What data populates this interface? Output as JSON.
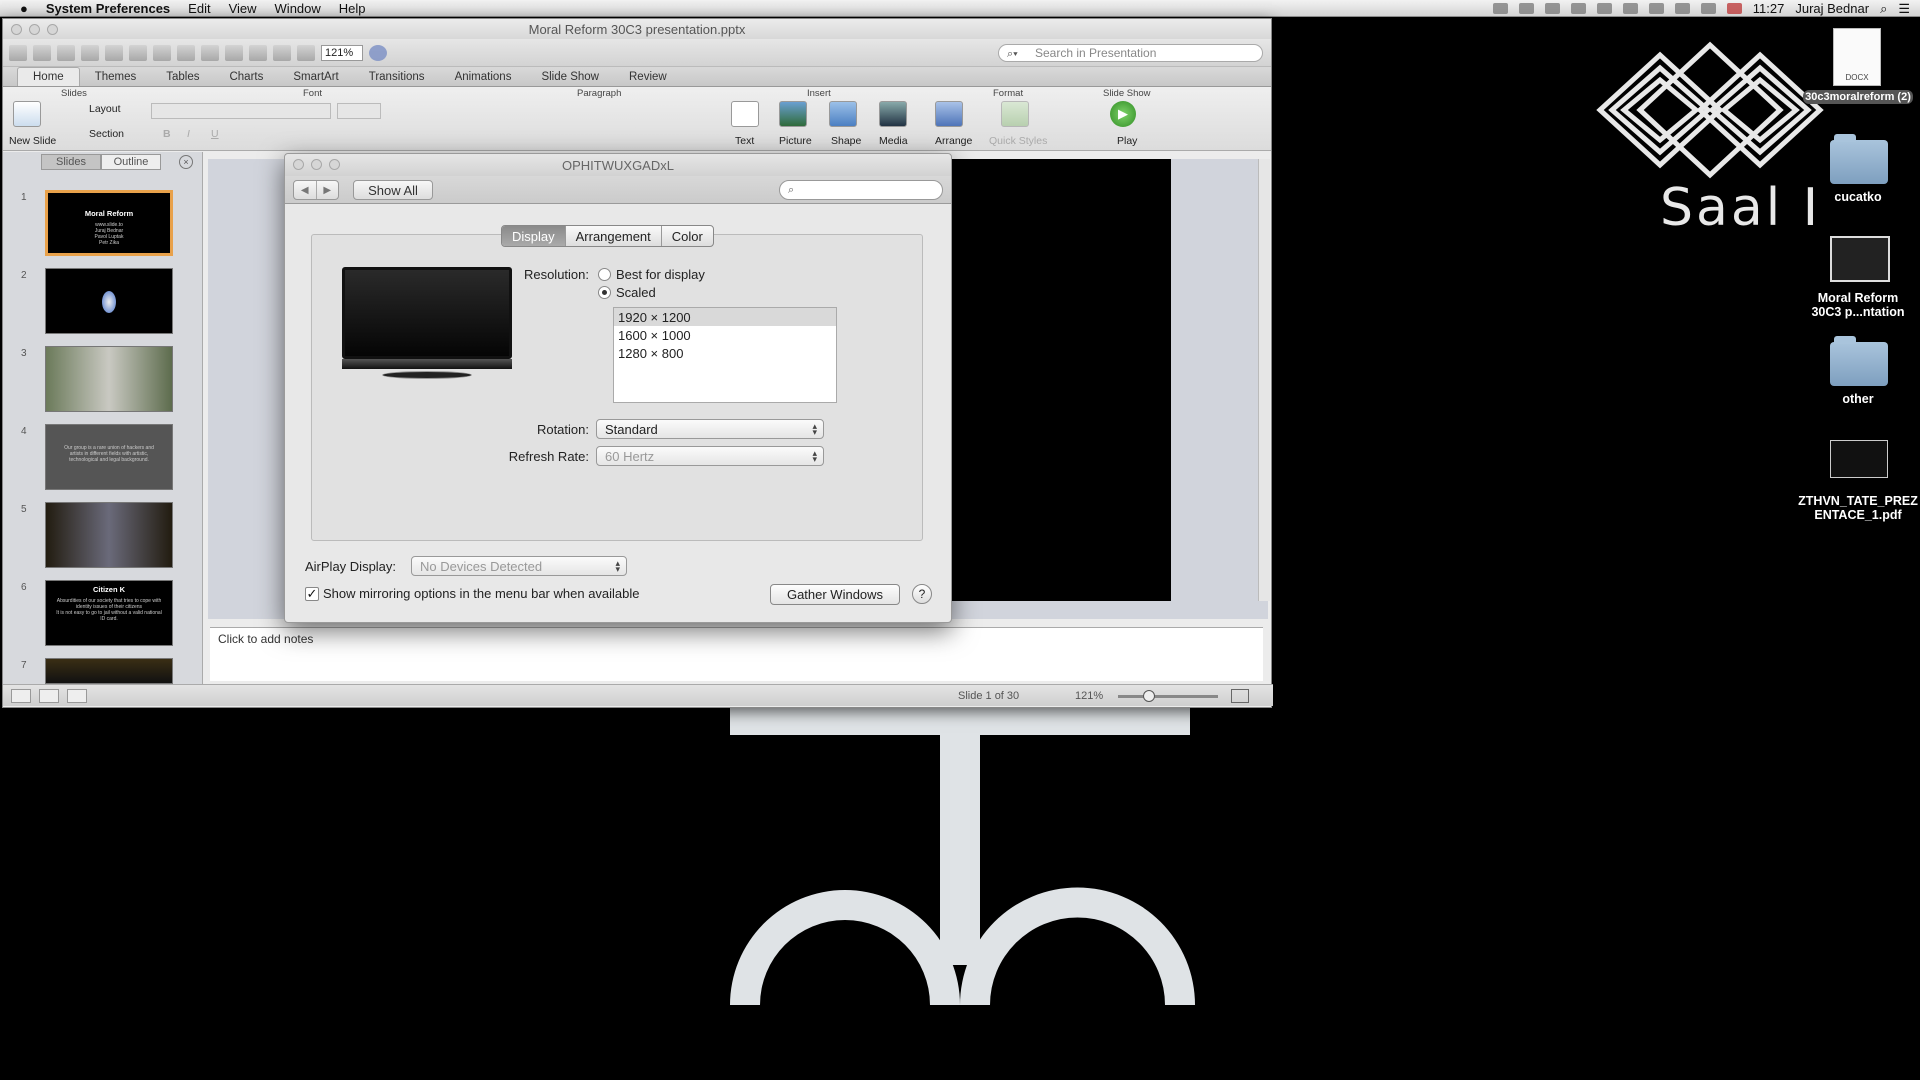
{
  "menubar": {
    "app": "System Preferences",
    "items": [
      "Edit",
      "View",
      "Window",
      "Help"
    ],
    "time": "11:27",
    "user": "Juraj Bednar"
  },
  "ppt": {
    "title": "Moral Reform 30C3 presentation.pptx",
    "zoom": "121%",
    "search_placeholder": "Search in Presentation",
    "tabs": [
      "Home",
      "Themes",
      "Tables",
      "Charts",
      "SmartArt",
      "Transitions",
      "Animations",
      "Slide Show",
      "Review"
    ],
    "groups": {
      "slides": "Slides",
      "font": "Font",
      "paragraph": "Paragraph",
      "insert": "Insert",
      "format": "Format",
      "slideshow": "Slide Show"
    },
    "buttons": {
      "new_slide": "New Slide",
      "layout": "Layout",
      "section": "Section",
      "text": "Text",
      "picture": "Picture",
      "shape": "Shape",
      "media": "Media",
      "arrange": "Arrange",
      "quick_styles": "Quick Styles",
      "play": "Play"
    },
    "sidebar_tabs": [
      "Slides",
      "Outline"
    ],
    "slides": [
      {
        "num": "1",
        "title": "Moral Reform",
        "sub": "www.slide.to\nJuraj Bednar\nPavol Luptak\nPetr Zika"
      },
      {
        "num": "2"
      },
      {
        "num": "3"
      },
      {
        "num": "4",
        "text": "Our group is a rare union of hackers and artists in different fields with artistic, technological and legal background."
      },
      {
        "num": "5"
      },
      {
        "num": "6",
        "title": "Citizen K",
        "text": "Absurdities of our society that tries to cope with identity issues of their citizens\nIt is not easy to go to jail without a valid national ID card."
      },
      {
        "num": "7"
      }
    ],
    "notes": "Click to add notes",
    "status_slide": "Slide 1 of 30",
    "status_zoom": "121%"
  },
  "sysprefs": {
    "title": "OPHITWUXGADxL",
    "show_all": "Show All",
    "segments": [
      "Display",
      "Arrangement",
      "Color"
    ],
    "resolution_label": "Resolution:",
    "best": "Best for display",
    "scaled": "Scaled",
    "resolutions": [
      "1920 × 1200",
      "1600 × 1000",
      "1280 × 800"
    ],
    "rotation_label": "Rotation:",
    "rotation": "Standard",
    "refresh_label": "Refresh Rate:",
    "refresh": "60 Hertz",
    "airplay_label": "AirPlay Display:",
    "airplay": "No Devices Detected",
    "mirror": "Show mirroring options in the menu bar when available",
    "gather": "Gather Windows",
    "help": "?"
  },
  "desktop": {
    "hall": "Saal I",
    "icons": [
      {
        "label": "30c3moralreform (2)",
        "badge": "DOCX"
      },
      {
        "label": "cucatko"
      },
      {
        "label": "Moral Reform 30C3 p...ntation"
      },
      {
        "label": "other"
      },
      {
        "label": "ZTHVN_TATE_PREZENTACE_1.pdf"
      }
    ]
  }
}
